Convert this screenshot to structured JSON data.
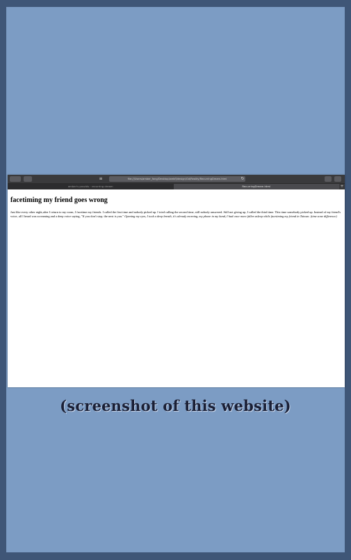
{
  "browser": {
    "address": "file:///Users/amber_fang/Desktop/webfl/design/Gd/Reality/RecurringDream.html",
    "tabs": [
      {
        "label": "amber's provids · recurring dream",
        "active": false
      },
      {
        "label": "RecurringDream.html",
        "active": true
      }
    ],
    "icons": [
      "back-forward-icon",
      "sidebar-icon",
      "reader-icon",
      "reload-icon",
      "share-icon",
      "tabs-overview-icon",
      "new-tab-icon"
    ]
  },
  "page": {
    "heading": "facetiming my friend goes wrong",
    "body_plain": "Just like every other night,after I return to my room, I facetime my friends. I called the first time and nobody picked up. I tried calling the second time, still nobody answered. Still not giving up, I called the third time. This time somebody picked up. Instead of my friend's voice, all I heard was screaming and a deep voice saying, \"If you don't stop, the next is you.\"",
    "body_italic": "Opening my eyes, I took a deep breath, it's already morning, my phone in my hand, I had once more fallen asleep while facetiming my friend in Taiwan. (time zone difference)"
  },
  "caption": "(screenshot of this website)",
  "colors": {
    "outer_border": "#3f5677",
    "frame_bg": "#7c9cc4",
    "toolbar": "#3a3a3c"
  }
}
